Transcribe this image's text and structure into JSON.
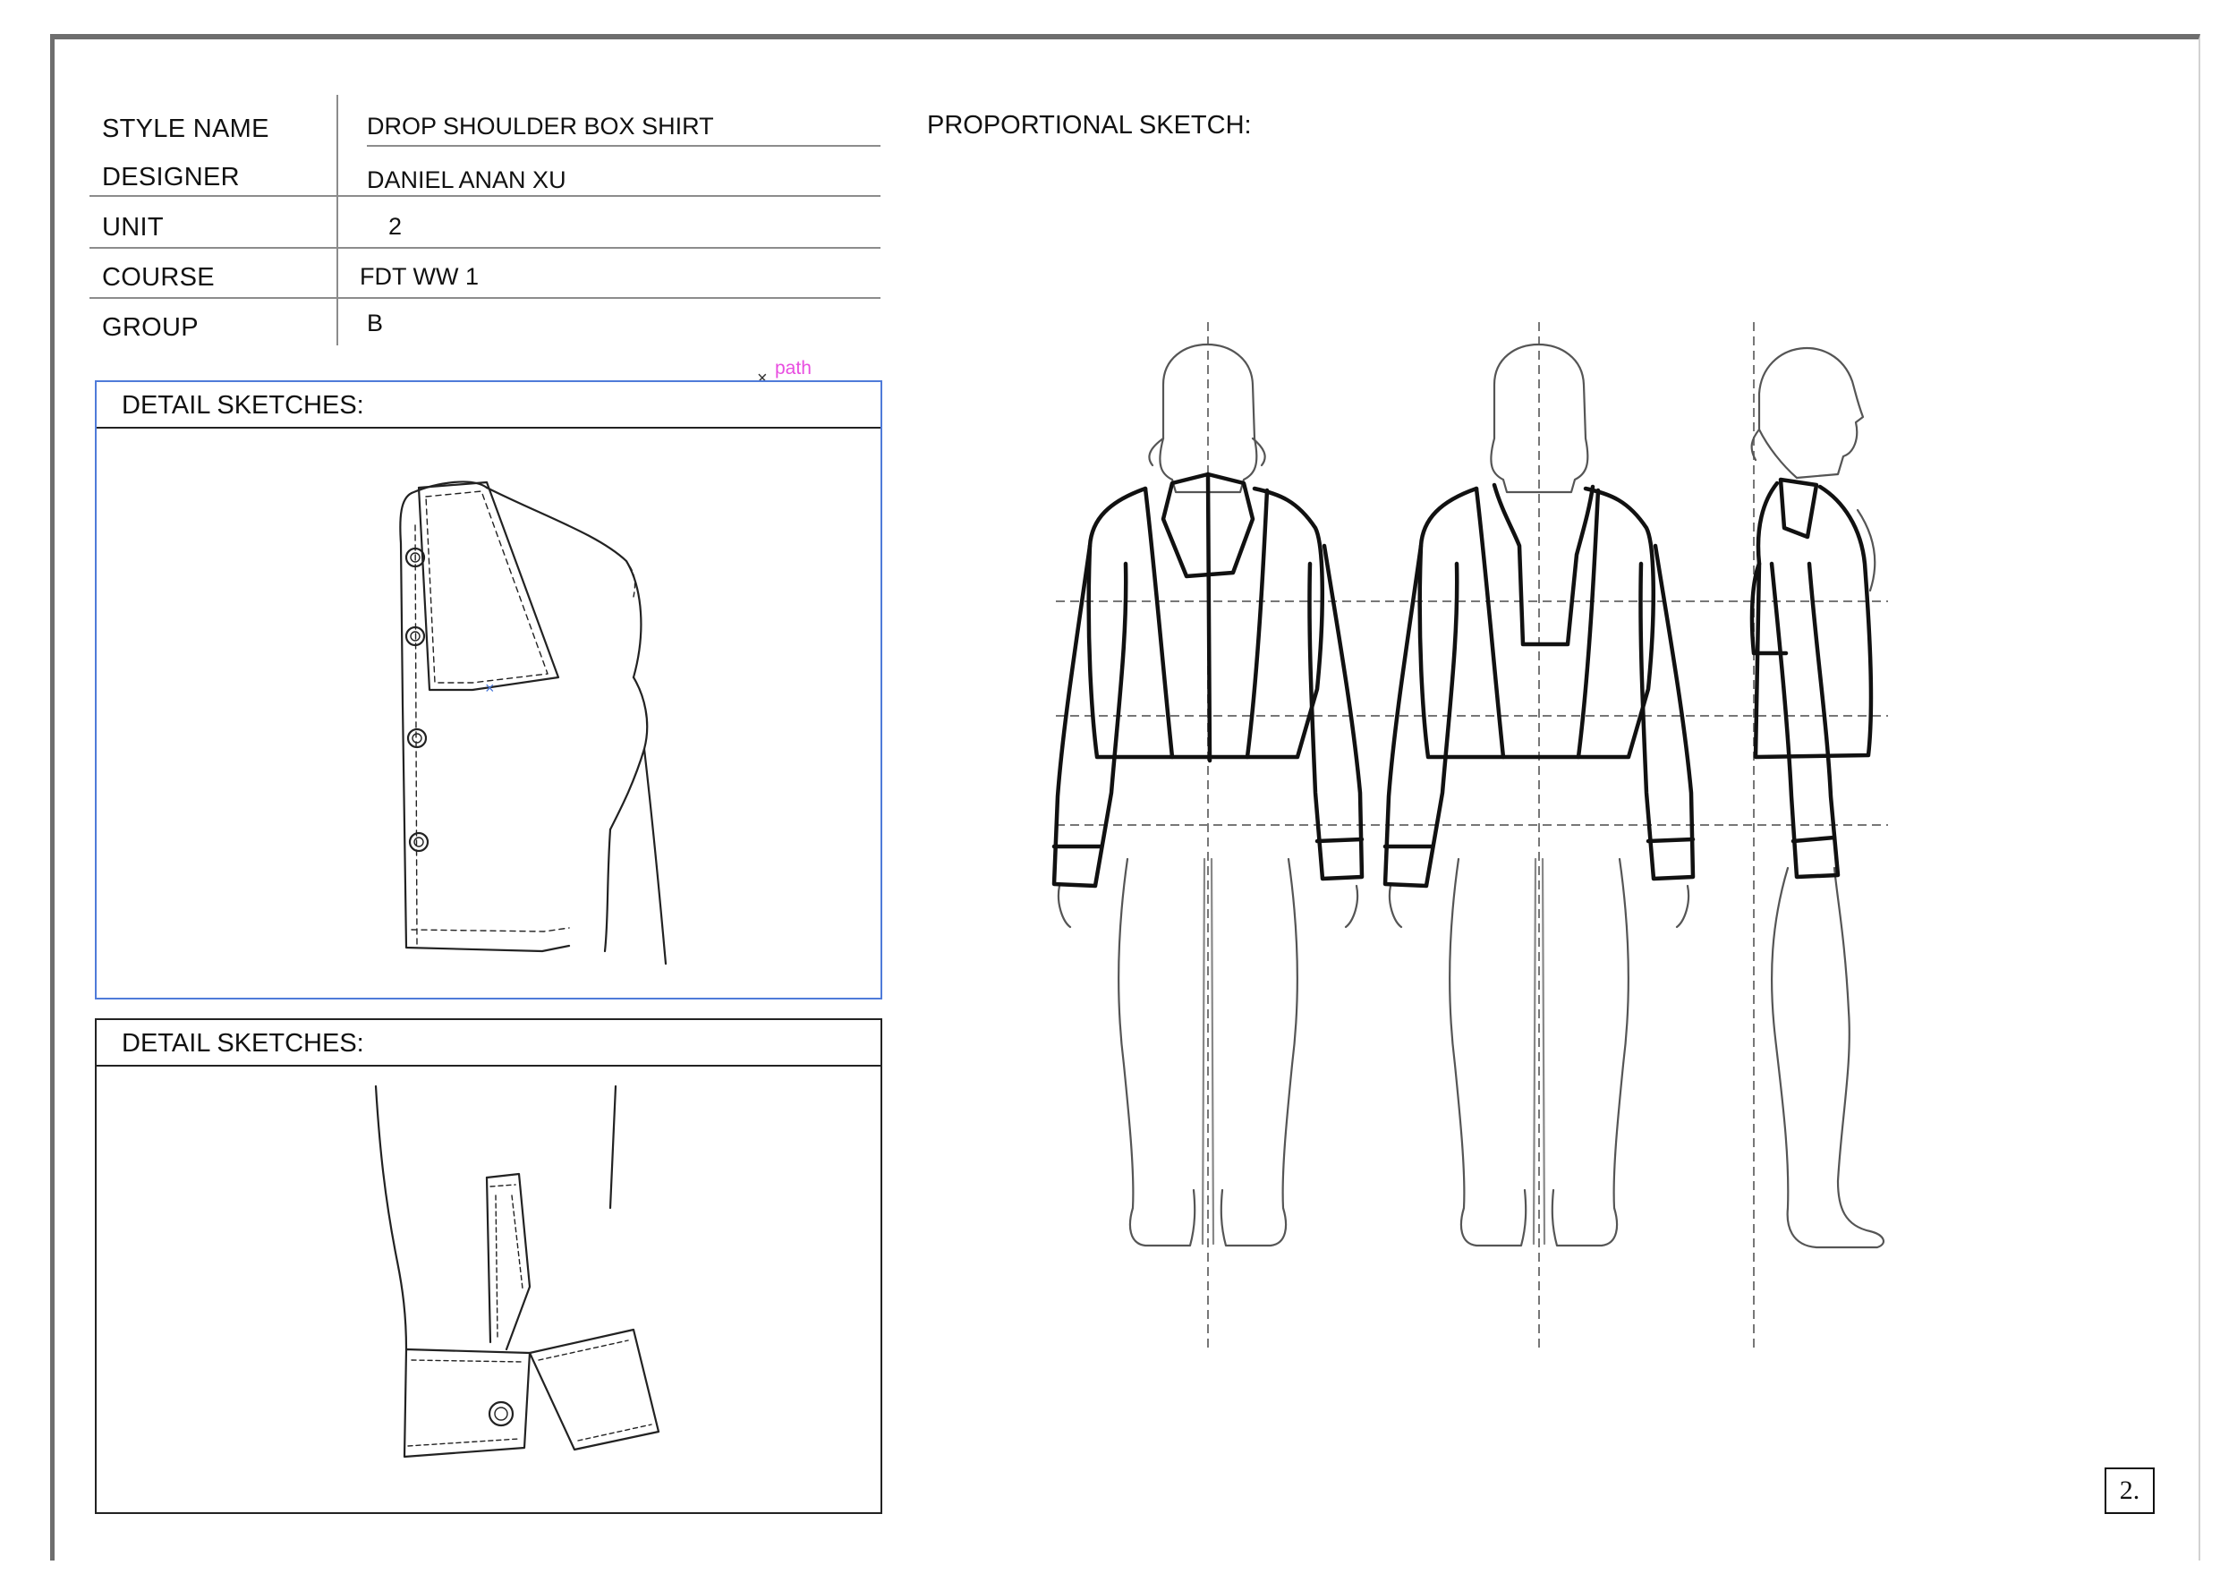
{
  "info_table": {
    "rows": [
      {
        "label": "STYLE NAME",
        "value": "DROP SHOULDER BOX SHIRT"
      },
      {
        "label": "DESIGNER",
        "value": "DANIEL ANAN XU"
      },
      {
        "label": "UNIT",
        "value": "2"
      },
      {
        "label": "COURSE",
        "value": "FDT WW 1"
      },
      {
        "label": "GROUP",
        "value": "B"
      }
    ]
  },
  "detail_panels": [
    {
      "title": "DETAIL SKETCHES:",
      "depicts": "collar-and-button-placket-drawing",
      "selected": true
    },
    {
      "title": "DETAIL SKETCHES:",
      "depicts": "sleeve-cuff-and-placket-drawing",
      "selected": false
    }
  ],
  "proportional_sketch": {
    "title": "PROPORTIONAL SKETCH:",
    "views": [
      "back-view-figure",
      "front-view-figure",
      "side-view-figure"
    ]
  },
  "annotation": {
    "marker": "×",
    "label": "path"
  },
  "page_number": "2.",
  "colors": {
    "frame": "#6e6e6e",
    "selection": "#4f7bd9",
    "annotation": "#e84de0",
    "ink": "#111111"
  }
}
